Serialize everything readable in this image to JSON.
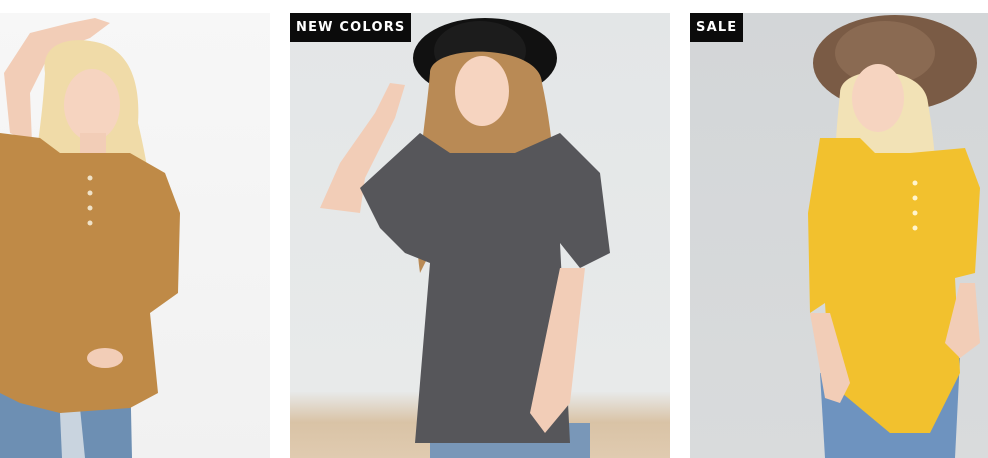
{
  "products": [
    {
      "badge": "",
      "photo": "model-mustard-henley-top",
      "colors": {
        "top": "#bf8a47",
        "hair": "#f0dba8",
        "jeans": "#6d8fb3"
      }
    },
    {
      "badge": "NEW COLORS",
      "photo": "model-charcoal-tee-black-hat",
      "colors": {
        "top": "#56565a",
        "hair": "#b98a55",
        "hat": "#111111"
      }
    },
    {
      "badge": "SALE",
      "photo": "model-yellow-henley-brown-hat",
      "colors": {
        "top": "#f2c12e",
        "hair": "#f2e2b6",
        "hat": "#7a5b45"
      }
    }
  ]
}
